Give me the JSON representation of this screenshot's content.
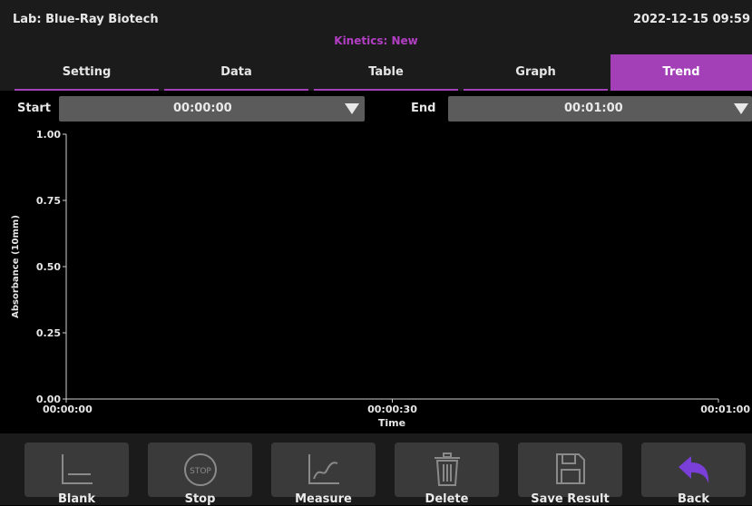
{
  "header": {
    "lab": "Lab: Blue-Ray Biotech",
    "datetime": "2022-12-15 09:59",
    "mode": "Kinetics: New"
  },
  "tabs": [
    {
      "label": "Setting",
      "active": false
    },
    {
      "label": "Data",
      "active": false
    },
    {
      "label": "Table",
      "active": false
    },
    {
      "label": "Graph",
      "active": false
    },
    {
      "label": "Trend",
      "active": true
    }
  ],
  "filter": {
    "start_label": "Start",
    "start_value": "00:00:00",
    "end_label": "End",
    "end_value": "00:01:00"
  },
  "chart_data": {
    "type": "line",
    "title": "",
    "xlabel": "Time",
    "ylabel": "Absorbance (10mm)",
    "x_ticks": [
      "00:00:00",
      "00:00:30",
      "00:01:00"
    ],
    "y_ticks": [
      "0.00",
      "0.25",
      "0.50",
      "0.75",
      "1.00"
    ],
    "ylim": [
      0,
      1
    ],
    "xlim": [
      "00:00:00",
      "00:01:00"
    ],
    "series": [],
    "grid": false
  },
  "buttons": [
    {
      "label": "Blank",
      "icon": "blank-icon",
      "enabled": false
    },
    {
      "label": "Stop",
      "icon": "stop-icon",
      "enabled": false
    },
    {
      "label": "Measure",
      "icon": "measure-icon",
      "enabled": false
    },
    {
      "label": "Delete",
      "icon": "trash-icon",
      "enabled": false
    },
    {
      "label": "Save Result",
      "icon": "save-icon",
      "enabled": false
    },
    {
      "label": "Back",
      "icon": "back-arrow-icon",
      "enabled": true
    }
  ],
  "colors": {
    "accent": "#a340b8",
    "accent_text": "#b33fc4",
    "panel": "#1b1b1b",
    "button": "#3a3a3a",
    "dropdown": "#5b5b5b",
    "back_arrow": "#7a3fd8"
  },
  "icons": {
    "dropdown": "caret-down-icon"
  }
}
